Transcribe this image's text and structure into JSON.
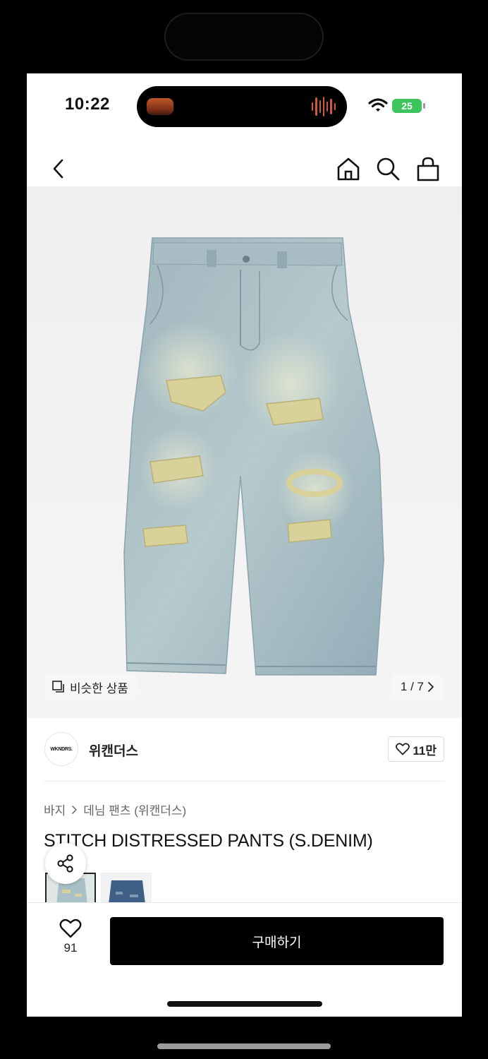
{
  "status_bar": {
    "time": "10:22",
    "battery": "25"
  },
  "nav": {
    "back_icon": "chevron-left-icon",
    "home_icon": "home-icon",
    "search_icon": "search-icon",
    "cart_icon": "shopping-bag-icon"
  },
  "product_image": {
    "similar_label": "비슷한 상품",
    "counter": "1 / 7",
    "current": 1,
    "total": 7
  },
  "brand": {
    "logo_text": "WKNDRS.",
    "name": "위캔더스",
    "likes": "11만"
  },
  "breadcrumb": {
    "category": "바지",
    "subcategory": "데님 팬츠 (위캔더스)"
  },
  "product": {
    "title": "STITCH DISTRESSED PANTS (S.DENIM)"
  },
  "bottom_bar": {
    "wish_count": "91",
    "buy_label": "구매하기"
  },
  "colors": {
    "denim_light": "#a9c0c7",
    "denim_dark": "#3f5f86",
    "distress": "#d9d19a",
    "buy_button": "#000000"
  }
}
